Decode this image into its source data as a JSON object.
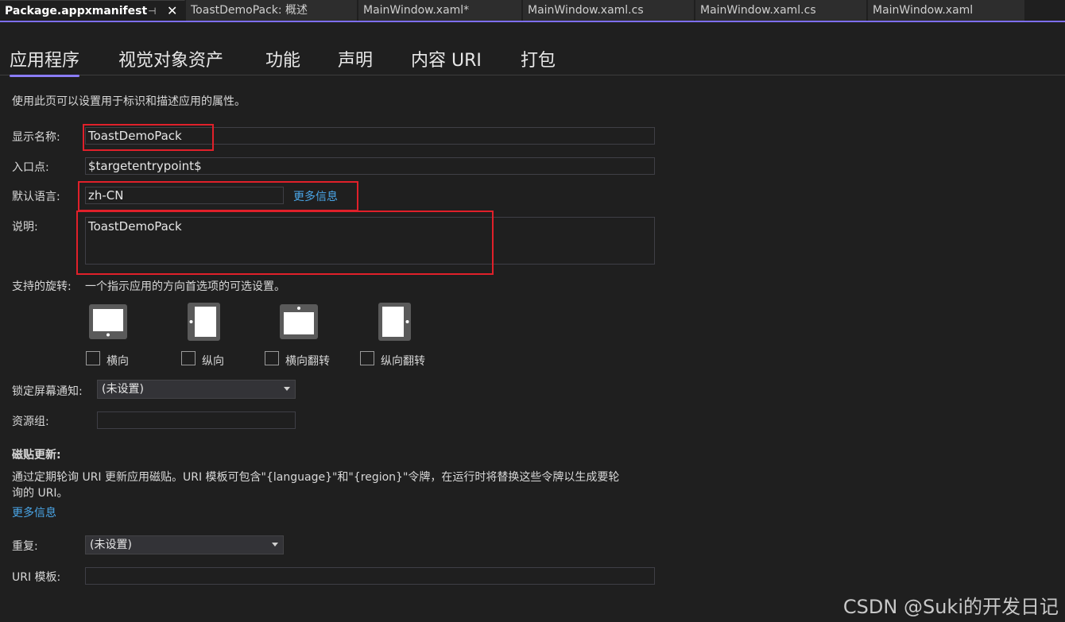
{
  "document_tabs": [
    {
      "label": "Package.appxmanifest",
      "active": true,
      "pin_icon": "pin-icon",
      "close_icon": "close-icon"
    },
    {
      "label": "ToastDemoPack: 概述",
      "active": false
    },
    {
      "label": "MainWindow.xaml*",
      "active": false
    },
    {
      "label": "MainWindow.xaml.cs",
      "active": false
    },
    {
      "label": "MainWindow.xaml.cs",
      "active": false
    },
    {
      "label": "MainWindow.xaml",
      "active": false
    }
  ],
  "section_tabs": [
    {
      "label": "应用程序",
      "active": true
    },
    {
      "label": "视觉对象资产",
      "active": false
    },
    {
      "label": "功能",
      "active": false
    },
    {
      "label": "声明",
      "active": false
    },
    {
      "label": "内容 URI",
      "active": false
    },
    {
      "label": "打包",
      "active": false
    }
  ],
  "page": {
    "intro": "使用此页可以设置用于标识和描述应用的属性。",
    "display_name": {
      "label": "显示名称:",
      "value": "ToastDemoPack"
    },
    "entry_point": {
      "label": "入口点:",
      "value": "$targetentrypoint$"
    },
    "default_language": {
      "label": "默认语言:",
      "value": "zh-CN",
      "link": "更多信息"
    },
    "description": {
      "label": "说明:",
      "value": "ToastDemoPack"
    },
    "rotation": {
      "label": "支持的旋转:",
      "hint": "一个指示应用的方向首选项的可选设置。",
      "options": [
        {
          "label": "横向",
          "icon": "landscape-device-icon",
          "checked": false
        },
        {
          "label": "纵向",
          "icon": "portrait-device-icon",
          "checked": false
        },
        {
          "label": "横向翻转",
          "icon": "landscape-flipped-device-icon",
          "checked": false
        },
        {
          "label": "纵向翻转",
          "icon": "portrait-flipped-device-icon",
          "checked": false
        }
      ]
    },
    "lock_screen": {
      "label": "锁定屏幕通知:",
      "value": "(未设置)"
    },
    "resource_group": {
      "label": "资源组:",
      "value": ""
    },
    "tile_update": {
      "heading": "磁贴更新:",
      "text_line1": "通过定期轮询 URI 更新应用磁贴。URI 模板可包含\"{language}\"和\"{region}\"令牌，在运行时将替换这些令牌以生成要轮",
      "text_line2": "询的 URI。",
      "link": "更多信息"
    },
    "recurrence": {
      "label": "重复:",
      "value": "(未设置)"
    },
    "uri_template": {
      "label": "URI 模板:",
      "value": ""
    }
  },
  "watermark": "CSDN @Suki的开发日记",
  "colors": {
    "accent": "#7e6ef6",
    "highlight_box": "#e0202a",
    "link": "#4aa6e8",
    "background": "#1f1f1f"
  }
}
